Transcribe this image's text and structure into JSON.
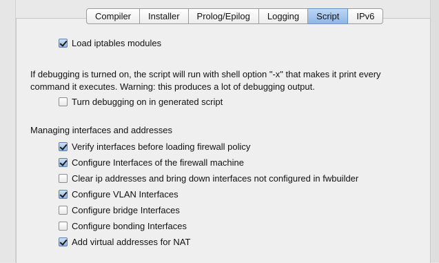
{
  "tabs": [
    {
      "label": "Compiler",
      "active": false
    },
    {
      "label": "Installer",
      "active": false
    },
    {
      "label": "Prolog/Epilog",
      "active": false
    },
    {
      "label": "Logging",
      "active": false
    },
    {
      "label": "Script",
      "active": true
    },
    {
      "label": "IPv6",
      "active": false
    }
  ],
  "options": {
    "load_iptables_modules": {
      "label": "Load iptables modules",
      "checked": true
    },
    "debugging_note_line1": "If debugging is turned on, the script will run with shell option \"-x\" that makes it print every",
    "debugging_note_line2": "command it executes. Warning: this produces a lot of debugging output.",
    "turn_debugging_on": {
      "label": "Turn debugging on in generated script",
      "checked": false
    },
    "section_heading": "Managing interfaces and addresses",
    "verify_interfaces": {
      "label": "Verify interfaces before loading firewall policy",
      "checked": true
    },
    "configure_interfaces": {
      "label": "Configure Interfaces of the firewall machine",
      "checked": true
    },
    "clear_ip_addresses": {
      "label": "Clear ip addresses and bring down interfaces not configured in fwbuilder",
      "checked": false
    },
    "configure_vlan": {
      "label": "Configure VLAN Interfaces",
      "checked": true
    },
    "configure_bridge": {
      "label": "Configure bridge Interfaces",
      "checked": false
    },
    "configure_bonding": {
      "label": "Configure bonding Interfaces",
      "checked": false
    },
    "add_virtual_addresses": {
      "label": "Add virtual addresses for NAT",
      "checked": true
    }
  }
}
